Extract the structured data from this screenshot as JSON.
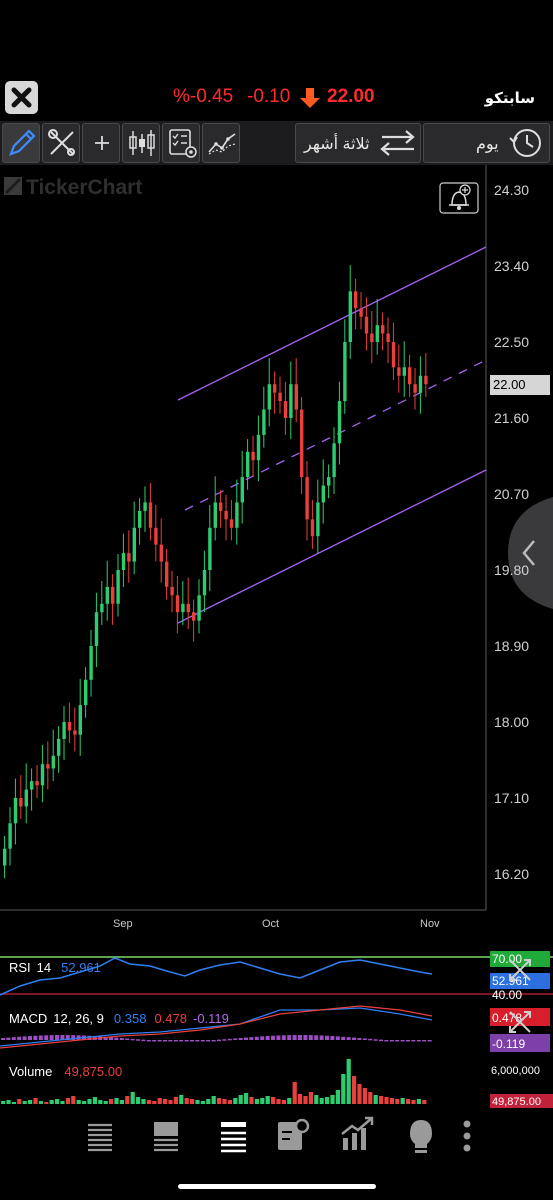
{
  "header": {
    "symbol": "سابتكو",
    "price": "22.00",
    "change": "-0.10",
    "change_pct": "%-0.45",
    "down_color": "#ff2b2b"
  },
  "toolbar": {
    "period_label": "ثلاثة أشهر",
    "interval_label": "يوم",
    "icons": [
      "pencil-icon",
      "tools-icon",
      "crosshair-icon",
      "candlestick-icon",
      "indicators-icon",
      "compare-icon",
      "swap-arrows-icon",
      "history-icon"
    ]
  },
  "chart": {
    "watermark": "TickerChart",
    "y_ticks": [
      "24.30",
      "23.40",
      "22.50",
      "21.60",
      "20.70",
      "19.80",
      "18.90",
      "18.00",
      "17.10",
      "16.20"
    ],
    "x_ticks": [
      "Sep",
      "Oct",
      "Nov"
    ],
    "last_price": "22.00",
    "channel_color": "#a463f2",
    "up_color": "#2ecc71",
    "down_color": "#e8403c"
  },
  "indicators": {
    "rsi": {
      "label": "RSI",
      "period": "14",
      "value": "52.961",
      "level_high": "70.00",
      "level_low": "40.00",
      "tag": "52.961"
    },
    "macd": {
      "label": "MACD",
      "params": "12, 26, 9",
      "macd": "0.358",
      "signal": "0.478",
      "hist": "-0.119",
      "tag_signal": "0.478",
      "tag_hist": "-0.119"
    },
    "volume": {
      "label": "Volume",
      "value": "49,875.00",
      "axis_top": "6,000,000",
      "tag": "49,875.00"
    }
  },
  "bottom_nav": {
    "icons": [
      "list-icon",
      "list-detail-icon",
      "list-active-icon",
      "portfolio-settings-icon",
      "chart-growth-icon",
      "idea-bulb-icon",
      "more-icon"
    ]
  }
}
